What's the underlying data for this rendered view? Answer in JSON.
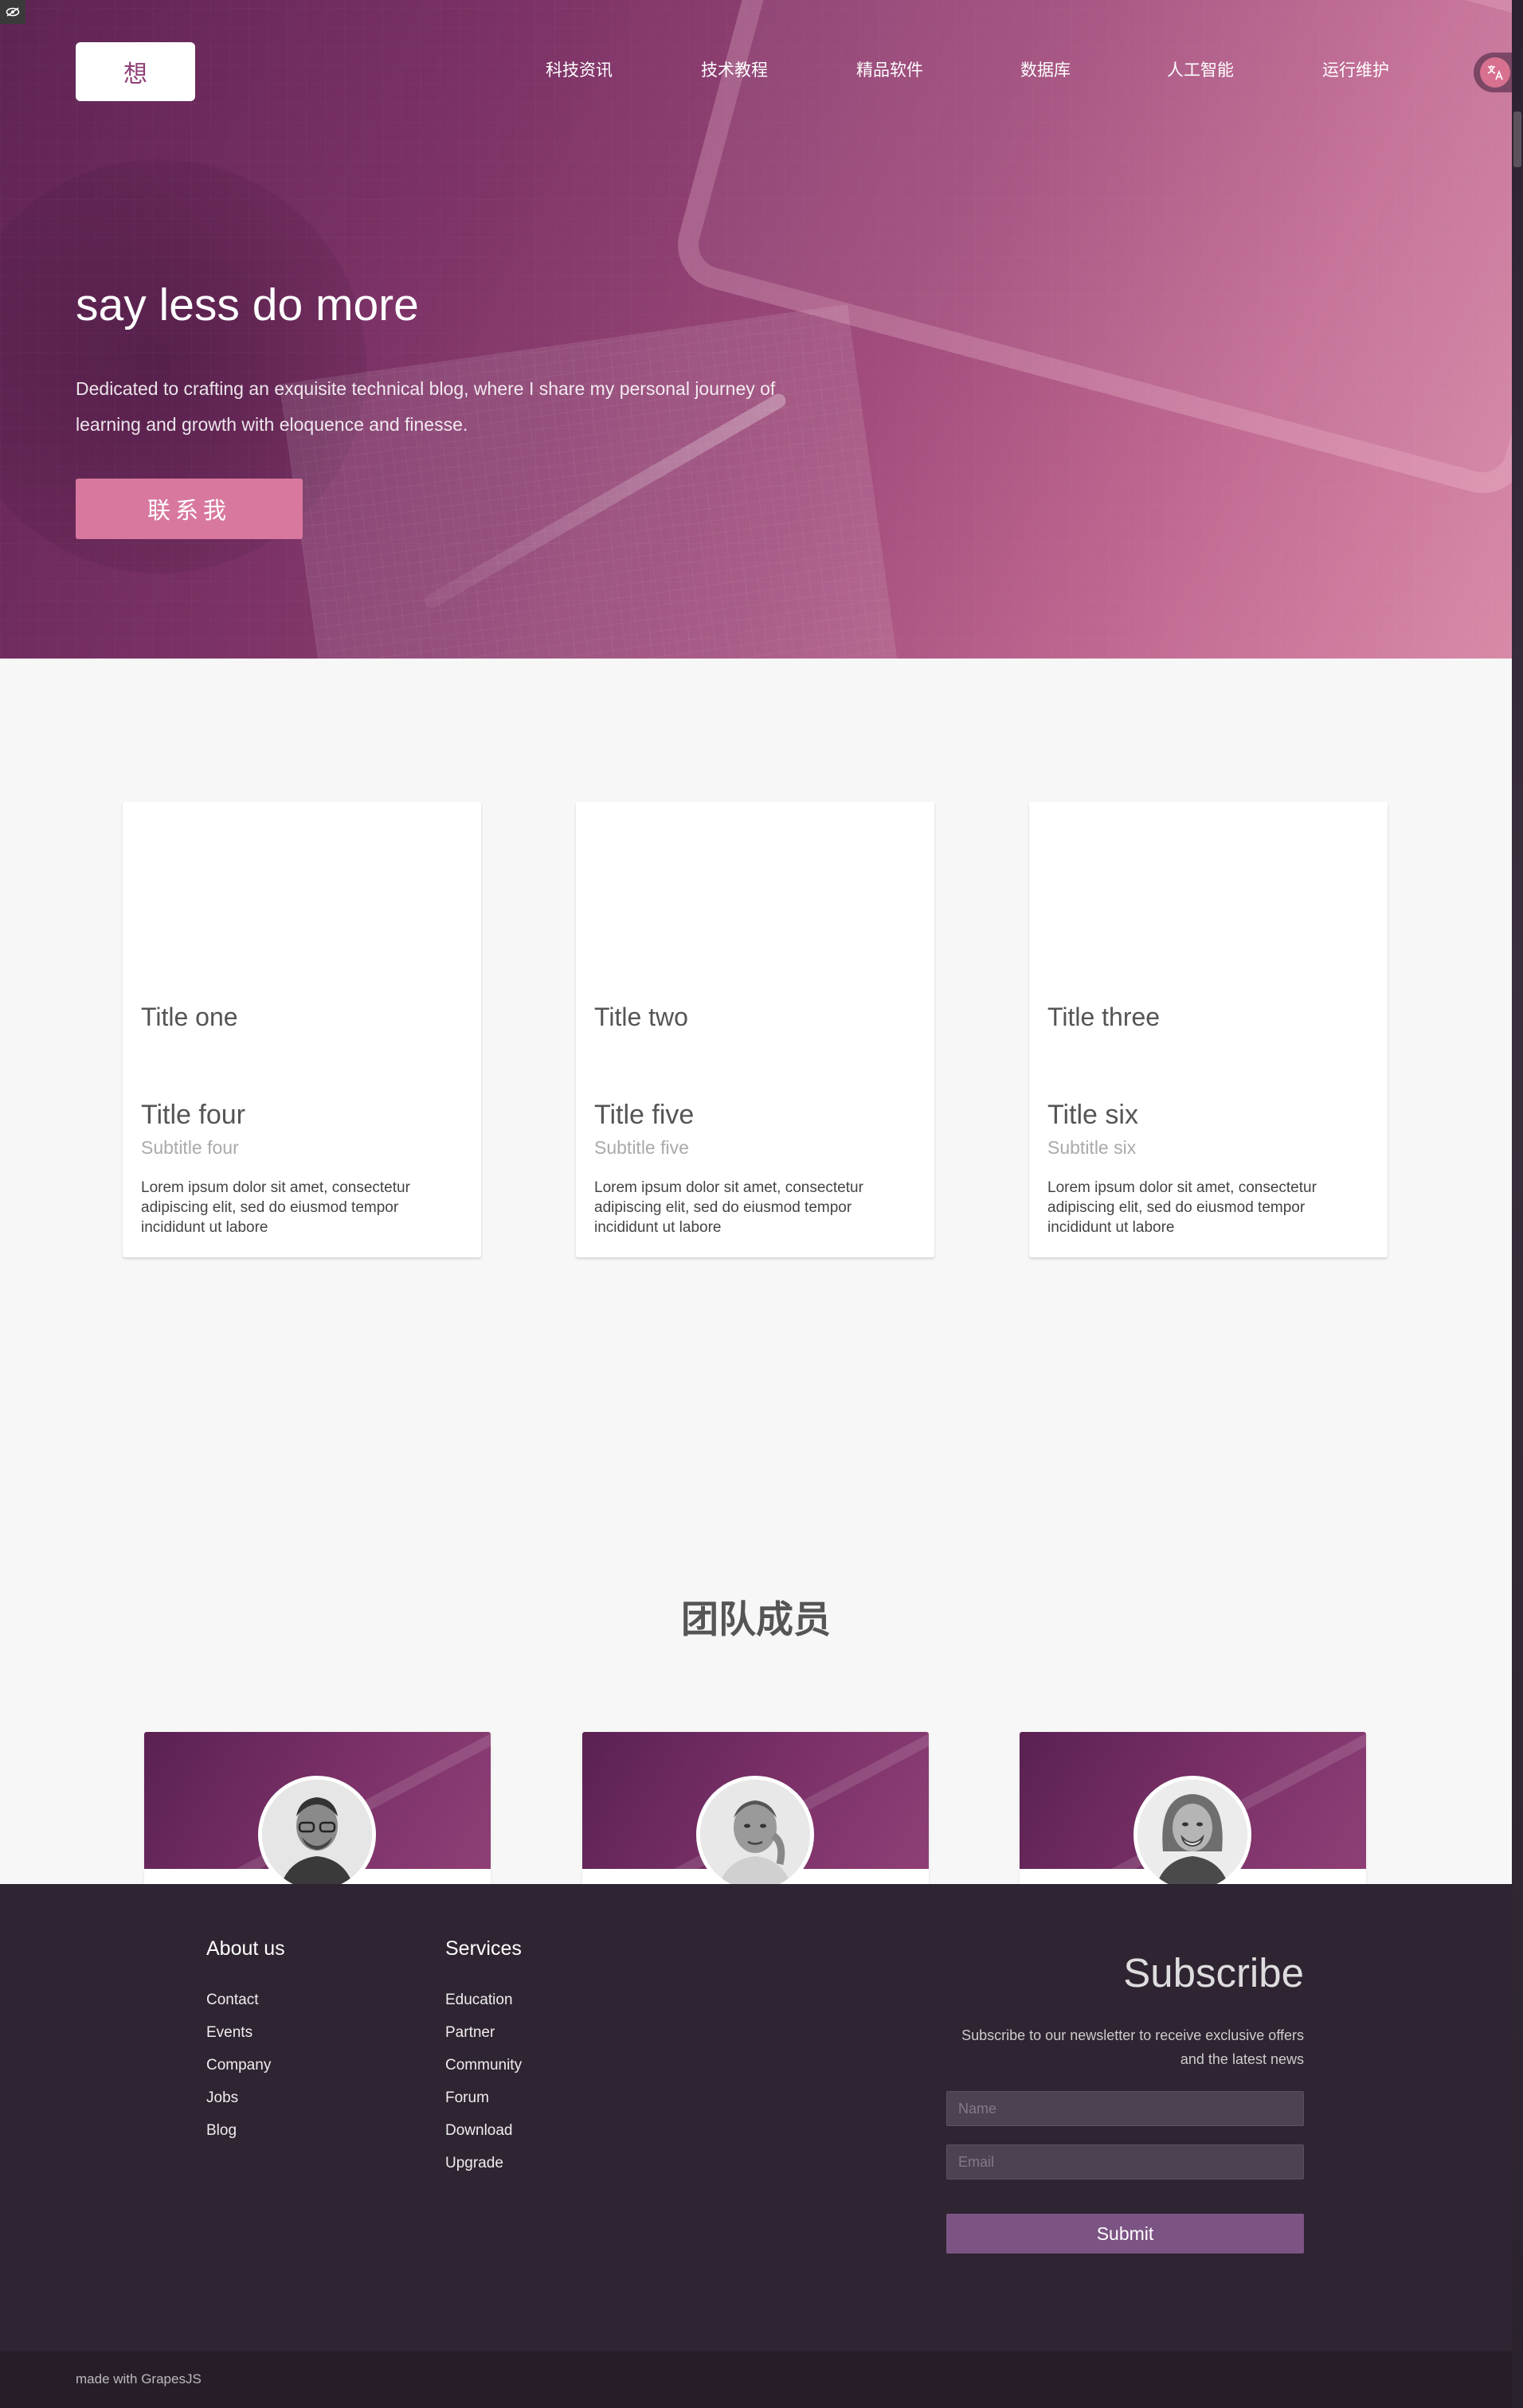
{
  "header": {
    "logo_text": "想",
    "nav": [
      "科技资讯",
      "技术教程",
      "精品软件",
      "数据库",
      "人工智能",
      "运行维护"
    ]
  },
  "hero": {
    "title": "say less do more",
    "description": "Dedicated to crafting an exquisite technical blog, where I share my personal journey of learning and growth with eloquence and finesse.",
    "button_label": "联系我"
  },
  "cards": [
    {
      "title": "Title one",
      "title2": "Title four",
      "subtitle": "Subtitle four",
      "text": "Lorem ipsum dolor sit amet, consectetur adipiscing elit, sed do eiusmod tempor incididunt ut labore"
    },
    {
      "title": "Title two",
      "title2": "Title five",
      "subtitle": "Subtitle five",
      "text": "Lorem ipsum dolor sit amet, consectetur adipiscing elit, sed do eiusmod tempor incididunt ut labore"
    },
    {
      "title": "Title three",
      "title2": "Title six",
      "subtitle": "Subtitle six",
      "text": "Lorem ipsum dolor sit amet, consectetur adipiscing elit, sed do eiusmod tempor incididunt ut labore"
    }
  ],
  "team": {
    "title": "团队成员"
  },
  "footer": {
    "about": {
      "title": "About us",
      "links": [
        "Contact",
        "Events",
        "Company",
        "Jobs",
        "Blog"
      ]
    },
    "services": {
      "title": "Services",
      "links": [
        "Education",
        "Partner",
        "Community",
        "Forum",
        "Download",
        "Upgrade"
      ]
    },
    "subscribe": {
      "title": "Subscribe",
      "text": "Subscribe to our newsletter to receive exclusive offers and the latest news",
      "name_placeholder": "Name",
      "email_placeholder": "Email",
      "button_label": "Submit"
    },
    "made_with": "made with GrapesJS"
  },
  "colors": {
    "brand_purple": "#8e3f76",
    "hero_button": "#d8789e",
    "footer_bg": "#2f2431",
    "submit_button": "#7b5484"
  },
  "icons": [
    "eye-icon",
    "translate-icon"
  ]
}
